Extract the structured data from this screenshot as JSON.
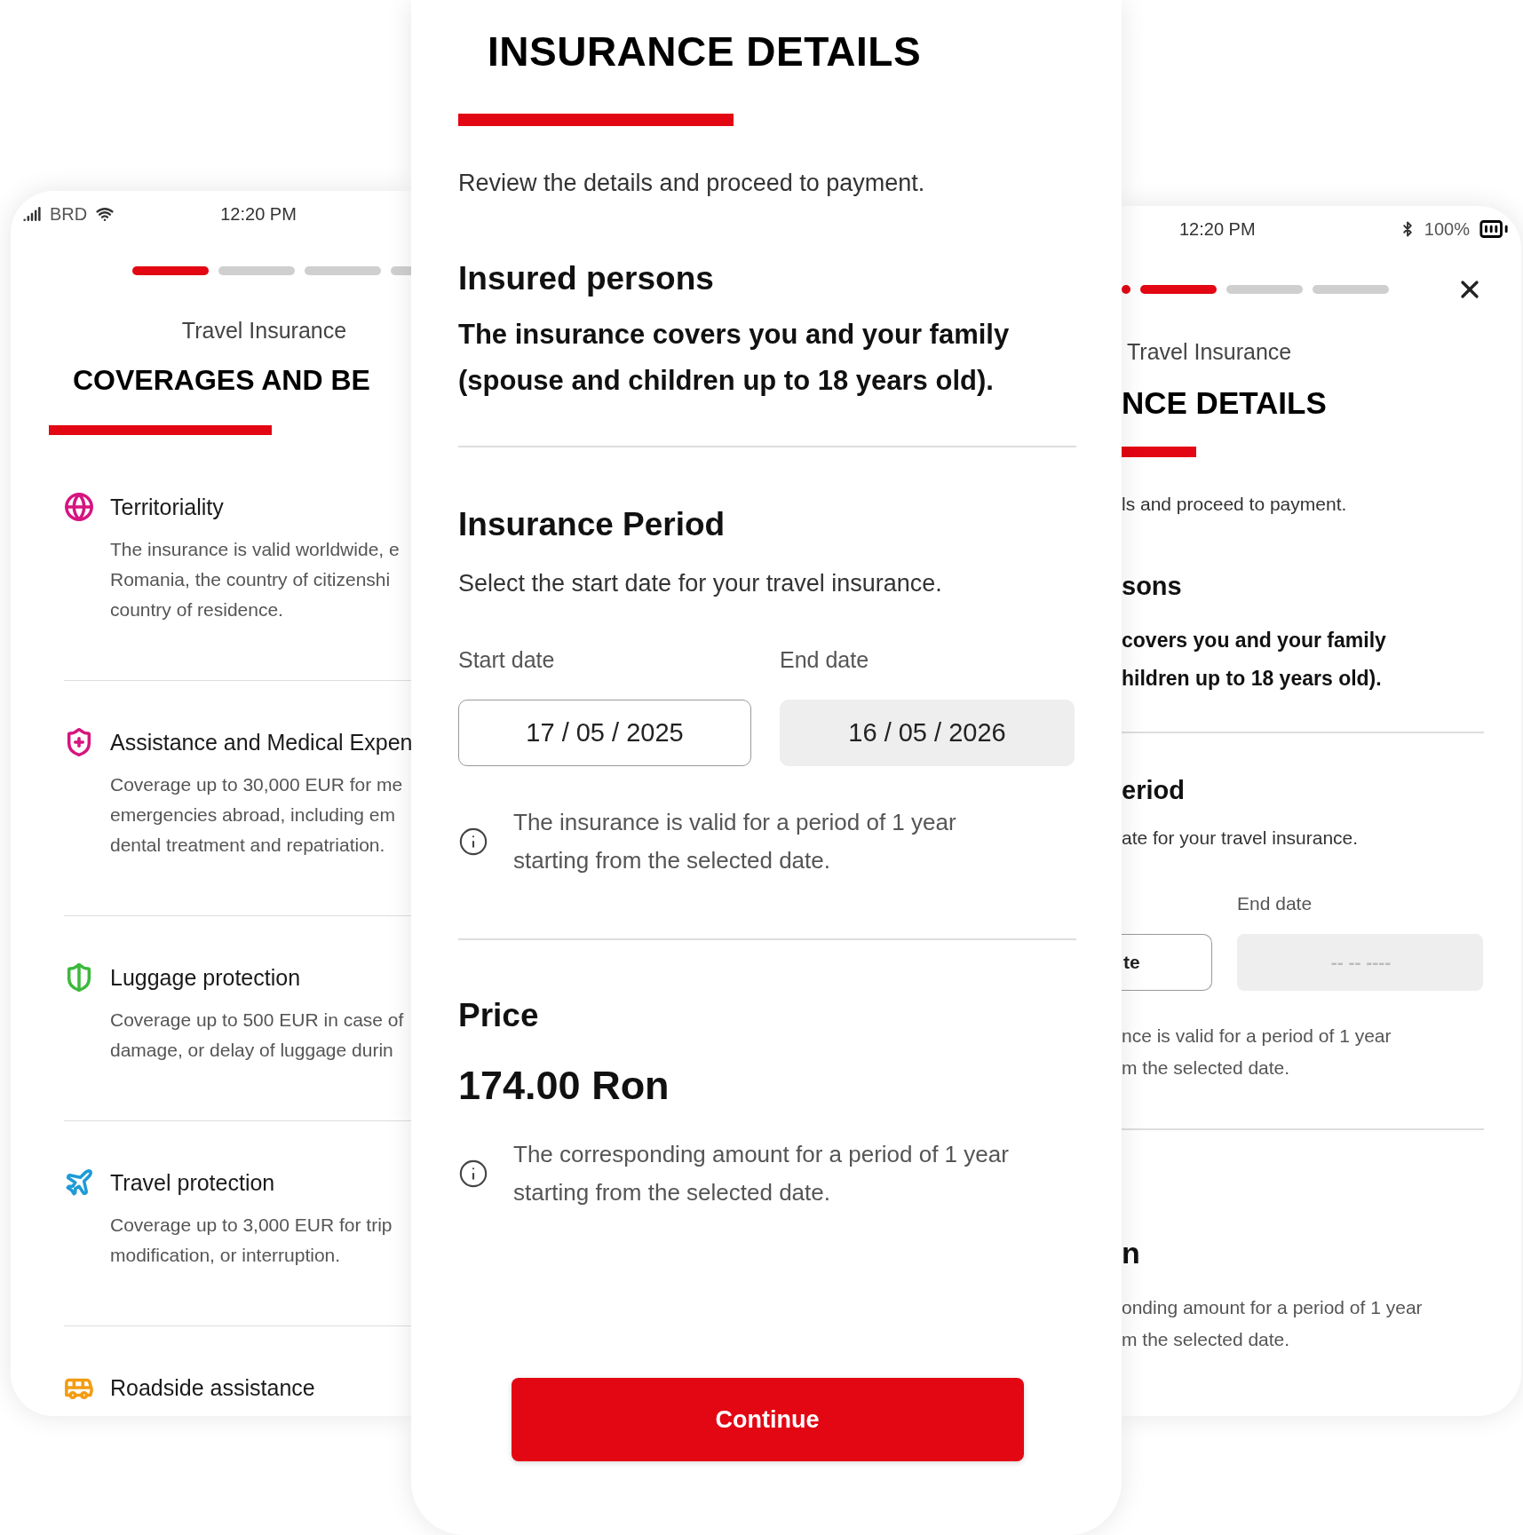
{
  "left_screen": {
    "status_bar": {
      "carrier": "BRD",
      "time": "12:20 PM"
    },
    "progress": [
      {
        "active": true
      },
      {
        "active": false
      },
      {
        "active": false
      },
      {
        "active": false
      }
    ],
    "subtitle": "Travel Insurance",
    "title": "COVERAGES AND BE",
    "coverages": [
      {
        "color": "#d6157f",
        "title": "Territoriality",
        "description": [
          "The insurance is valid worldwide, e",
          "Romania, the country of citizenshi",
          "country of residence."
        ]
      },
      {
        "color": "#d6157f",
        "title": "Assistance and Medical Expen",
        "description": [
          "Coverage up to 30,000 EUR for me",
          "emergencies abroad, including em",
          "dental treatment and repatriation."
        ]
      },
      {
        "color": "#3cb93c",
        "title": "Luggage protection",
        "description": [
          "Coverage up to 500 EUR in case of",
          "damage, or delay of luggage durin"
        ]
      },
      {
        "color": "#1e9bd7",
        "title": "Travel protection",
        "description": [
          "Coverage up to 3,000 EUR for trip",
          "modification, or interruption."
        ]
      },
      {
        "color": "#f39c12",
        "title": "Roadside assistance"
      }
    ]
  },
  "main_screen": {
    "title": "INSURANCE DETAILS",
    "intro": "Review the details and proceed to payment.",
    "insured_persons": {
      "heading": "Insured persons",
      "text": [
        "The insurance covers you and your family",
        "(spouse and children up to 18 years old)."
      ]
    },
    "insurance_period": {
      "heading": "Insurance Period",
      "text": "Select the start date for your travel insurance.",
      "start_date": {
        "label": "Start date",
        "value": "17 / 05 / 2025",
        "disabled": false
      },
      "end_date": {
        "label": "End date",
        "value": "16 / 05 / 2026",
        "disabled": true
      },
      "note": [
        "The insurance is valid for a period of 1 year",
        "starting from the selected date."
      ]
    },
    "price": {
      "heading": "Price",
      "amount": "174.00 Ron",
      "note": [
        "The corresponding amount for a period of 1 year",
        "starting from the selected date."
      ]
    },
    "button": "Continue"
  },
  "right_screen": {
    "status_bar": {
      "time": "12:20 PM",
      "battery": "100%"
    },
    "progress": [
      {
        "active": true
      },
      {
        "active": true
      },
      {
        "active": false
      },
      {
        "active": false
      }
    ],
    "subtitle": "Travel Insurance",
    "title": "NCE DETAILS",
    "intro": "ls and proceed to payment.",
    "persons_heading": "sons",
    "persons_text": [
      "covers you and your family",
      "hildren up to 18 years old)."
    ],
    "period_heading": "eriod",
    "period_text": "ate for your travel insurance.",
    "start_date": {
      "value": "te",
      "disabled": false
    },
    "end_date": {
      "label": "End date",
      "placeholder": "-- -- ----",
      "disabled": true
    },
    "period_note": [
      "nce is valid for a period of 1 year",
      "m the selected date."
    ],
    "price_heading": "n",
    "price_note": [
      "onding amount for a period of 1 year",
      "m the selected date."
    ]
  }
}
